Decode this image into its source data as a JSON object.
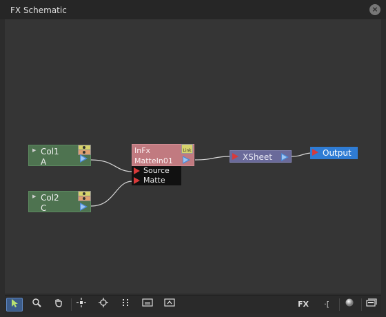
{
  "window": {
    "title": "FX Schematic",
    "close_icon": "close-icon"
  },
  "nodes": {
    "col1": {
      "name": "Col1",
      "column": "A"
    },
    "col2": {
      "name": "Col2",
      "column": "C"
    },
    "infx": {
      "name": "InFx",
      "id": "MatteIn01",
      "link_label": "Link",
      "ports": [
        "Source",
        "Matte"
      ]
    },
    "xsheet": {
      "name": "XSheet"
    },
    "output": {
      "name": "Output"
    }
  },
  "toolbar": {
    "left": [
      "selection-mode-icon",
      "zoom-mode-icon",
      "hand-mode-icon",
      "fit-to-window-icon",
      "focus-on-current-icon",
      "reorder-nodes-icon",
      "reset-size-icon",
      "maximize-nodes-icon"
    ],
    "right": {
      "fx_label": "FX",
      "bracket_label": "·[",
      "preview_icon": "preview-sphere-icon",
      "stage_toggle_icon": "toggle-stage-icon"
    }
  },
  "colors": {
    "column_node": "#4e7350",
    "fx_node": "#c17a80",
    "xsheet_node": "#6a6a9a",
    "output_node": "#2f7cd4",
    "selected_tool": "#3c5c8a"
  }
}
